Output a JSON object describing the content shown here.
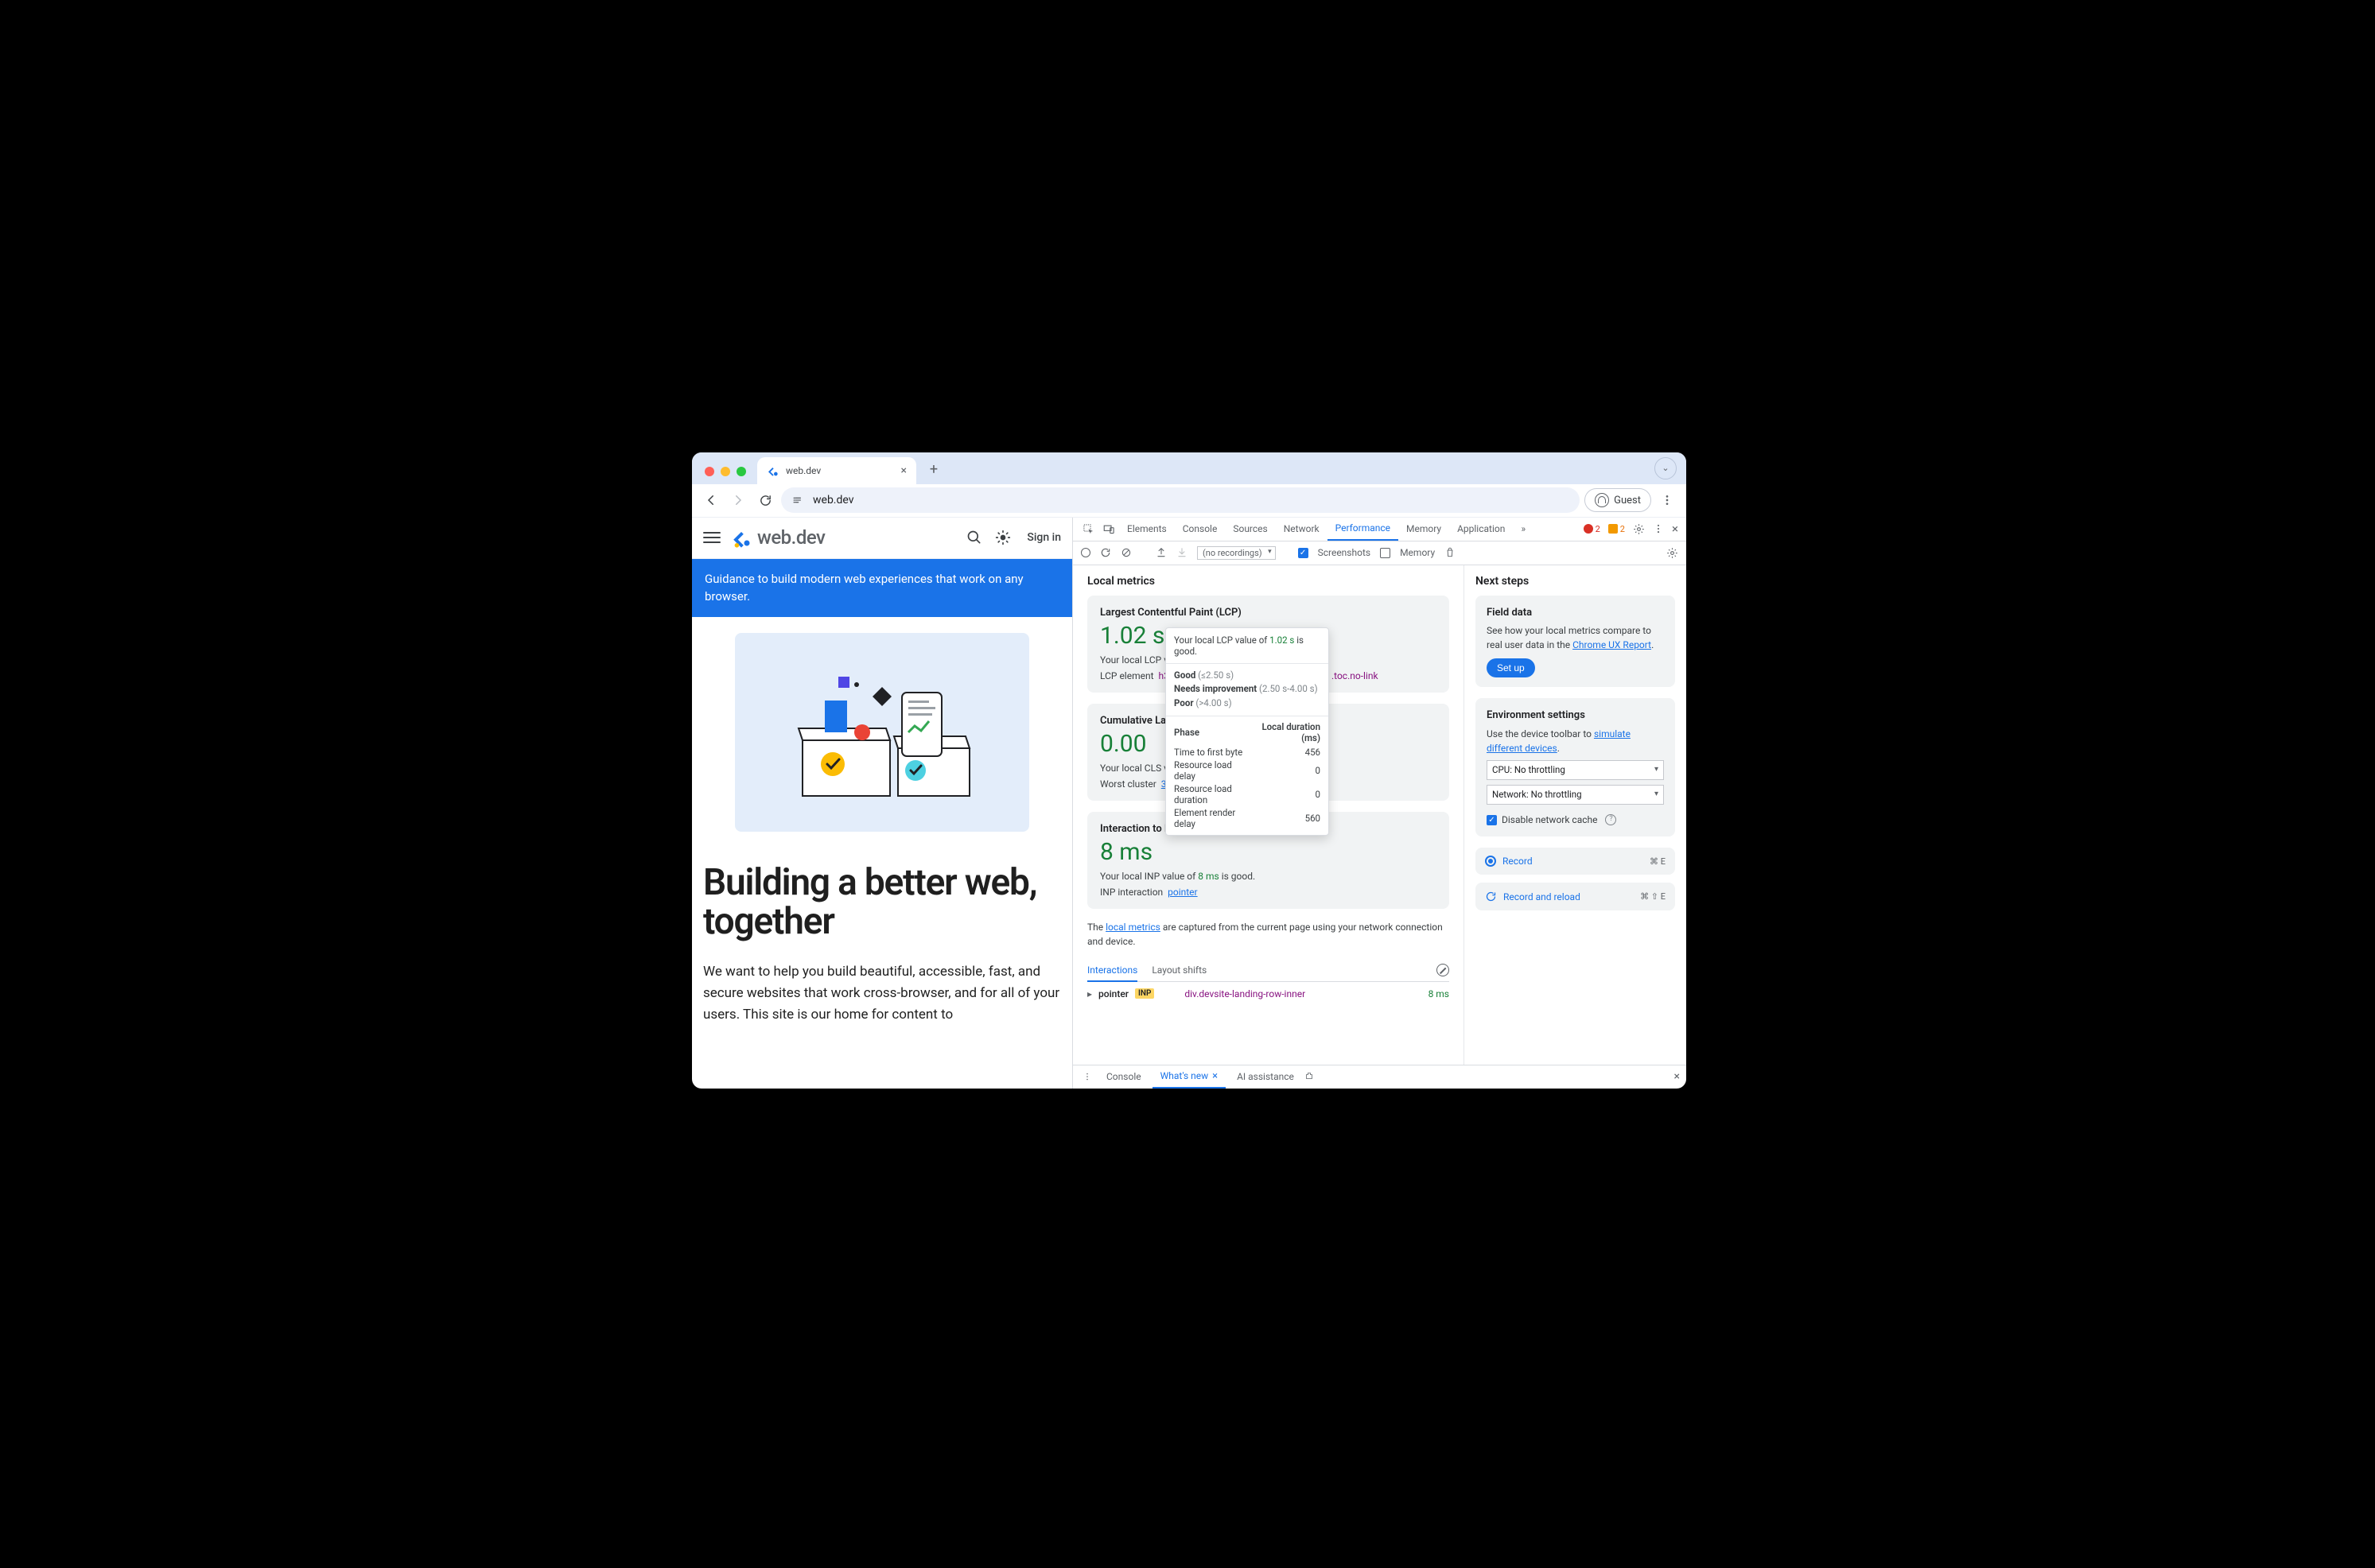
{
  "browser": {
    "tab_title": "web.dev",
    "url": "web.dev",
    "guest_label": "Guest"
  },
  "page": {
    "logo_text": "web.dev",
    "signin": "Sign in",
    "banner": "Guidance to build modern web experiences that work on any browser.",
    "hero_title": "Building a better web, together",
    "hero_body": "We want to help you build beautiful, accessible, fast, and secure websites that work cross-browser, and for all of your users. This site is our home for content to"
  },
  "devtools": {
    "tabs": [
      "Elements",
      "Console",
      "Sources",
      "Network",
      "Performance",
      "Memory",
      "Application"
    ],
    "active_tab": "Performance",
    "errors": "2",
    "warnings": "2",
    "toolbar": {
      "recordings": "(no recordings)",
      "cb_screenshots": "Screenshots",
      "cb_memory": "Memory"
    },
    "local_metrics_title": "Local metrics",
    "lcp": {
      "title": "Largest Contentful Paint (LCP)",
      "value": "1.02 s",
      "desc_prefix": "Your local LCP valu",
      "elm_label": "LCP element",
      "elm_tag": "h3#b",
      "elm_suffix": ".toc.no-link"
    },
    "cls": {
      "title": "Cumulative Layo",
      "value": "0.00",
      "desc_prefix": "Your local CLS valu",
      "worst_label": "Worst cluster",
      "worst_link": "3 shifts"
    },
    "inp": {
      "title": "Interaction to Next Paint (INP)",
      "value": "8 ms",
      "desc": "Your local INP value of 8 ms is good.",
      "desc_prefix": "Your local INP value of ",
      "desc_val": "8 ms",
      "desc_suffix": " is good.",
      "int_label": "INP interaction",
      "int_link": "pointer"
    },
    "note_prefix": "The ",
    "note_link": "local metrics",
    "note_suffix": " are captured from the current page using your network connection and device.",
    "subtabs": {
      "interactions": "Interactions",
      "layoutshifts": "Layout shifts"
    },
    "interaction_row": {
      "kind": "pointer",
      "chip": "INP",
      "target": "div.devsite-landing-row-inner",
      "dur": "8 ms"
    },
    "tooltip": {
      "top_prefix": "Your local LCP value of ",
      "top_val": "1.02 s",
      "top_suffix": " is good.",
      "good": "Good",
      "good_range": "(≤2.50 s)",
      "ni": "Needs improvement",
      "ni_range": "(2.50 s-4.00 s)",
      "poor": "Poor",
      "poor_range": "(>4.00 s)",
      "col_phase": "Phase",
      "col_dur": "Local duration (ms)",
      "rows": [
        {
          "label": "Time to first byte",
          "val": "456"
        },
        {
          "label": "Resource load delay",
          "val": "0"
        },
        {
          "label": "Resource load duration",
          "val": "0"
        },
        {
          "label": "Element render delay",
          "val": "560"
        }
      ]
    },
    "side": {
      "next_steps": "Next steps",
      "field_title": "Field data",
      "field_body_prefix": "See how your local metrics compare to real user data in the ",
      "field_link": "Chrome UX Report",
      "setup": "Set up",
      "env_title": "Environment settings",
      "env_body_prefix": "Use the device toolbar to ",
      "env_link": "simulate different devices",
      "cpu": "CPU: No throttling",
      "net": "Network: No throttling",
      "disable_cache": "Disable network cache",
      "record": "Record",
      "record_kbd": "⌘ E",
      "record_reload": "Record and reload",
      "record_reload_kbd": "⌘ ⇧ E"
    },
    "drawer": {
      "console": "Console",
      "whatsnew": "What's new",
      "ai": "AI assistance"
    }
  }
}
